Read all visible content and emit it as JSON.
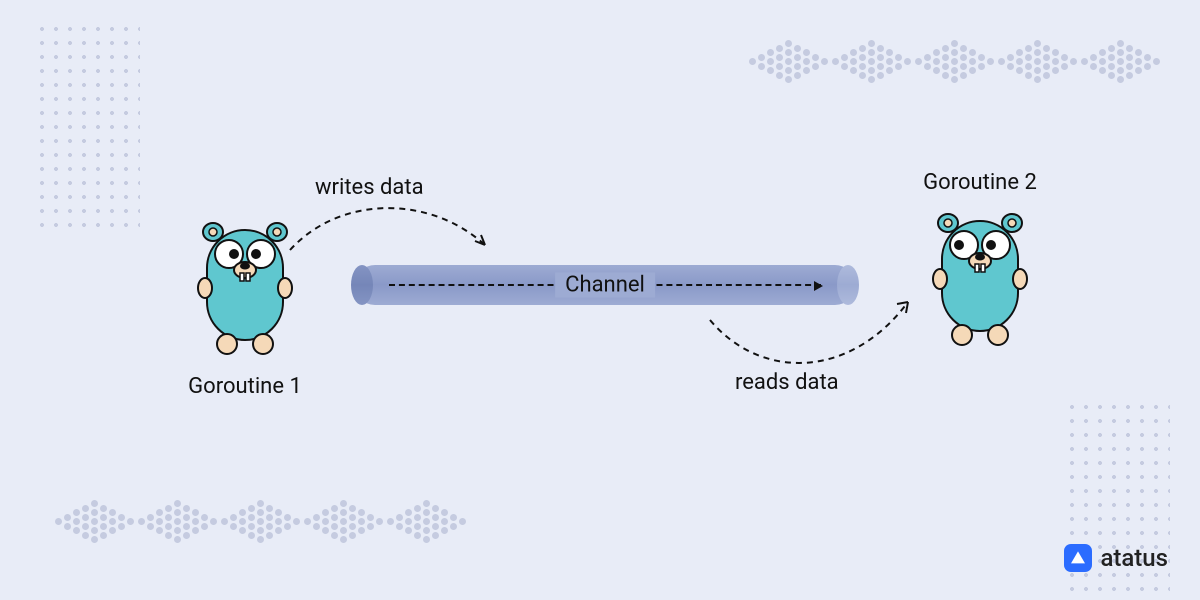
{
  "diagram": {
    "goroutine_left_label": "Goroutine 1",
    "goroutine_right_label": "Goroutine 2",
    "writes_label": "writes data",
    "reads_label": "reads data",
    "channel_label": "Channel"
  },
  "branding": {
    "logo_text": "atatus",
    "logo_icon_name": "atatus-logo-icon"
  },
  "decor": {
    "chevron_top_right": true,
    "chevron_bottom_left": true,
    "dotgrid_top_left": true,
    "dotgrid_bottom_right": true
  },
  "colors": {
    "background": "#e8ecf7",
    "decor_dot": "#c5cbe0",
    "pipe": "#9dabd3",
    "gopher_body": "#5fc7cf",
    "gopher_outline": "#1a1a1a",
    "text": "#111111",
    "logo_blue": "#2b6cff"
  }
}
